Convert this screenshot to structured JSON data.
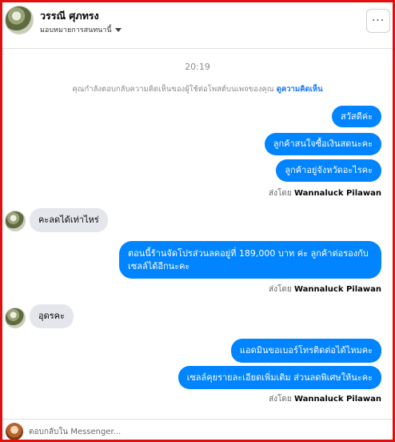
{
  "header": {
    "contact_name": "วรรณี ศุภทรง",
    "assign_label": "มอบหมายการสนทนานี้",
    "more_label": "···"
  },
  "thread": {
    "time": "20:19",
    "notice_text": "คุณกำลังตอบกลับความคิดเห็นของผู้ใช้ต่อโพสต์บนเพจของคุณ",
    "notice_link": "ดูความคิดเห็น",
    "sent_by_prefix": "ส่งโดย",
    "sent_by_name": "Wannaluck Pilawan",
    "messages": [
      {
        "text": "สวัสดีค่ะ"
      },
      {
        "text": "ลูกค้าสนใจซื้อเงินสดนะคะ"
      },
      {
        "text": "ลูกค้าอยู่จังหวัดอะไรคะ"
      },
      {
        "text": "คะลดได้เท่าไหร่"
      },
      {
        "text": "ตอนนี้ร้านจัดโปรส่วนลดอยู่ที่ 189,000 บาท  ค่ะ ลูกค้าต่อรองกับเซลล์ได้อีกนะคะ"
      },
      {
        "text": "อุดรคะ"
      },
      {
        "text": "แอดมินขอเบอร์โทรติดต่อได้ไหมคะ"
      },
      {
        "text": "เซลล์คุยรายละเอียดเพิ่มเติม ส่วนลดพิเศษให้นะคะ"
      }
    ]
  },
  "composer": {
    "placeholder": "ตอบกลับใน Messenger..."
  },
  "colors": {
    "outgoing_bubble": "#0084ff",
    "incoming_bubble": "#e4e6eb",
    "link": "#1877f2",
    "frame": "#e01010"
  }
}
